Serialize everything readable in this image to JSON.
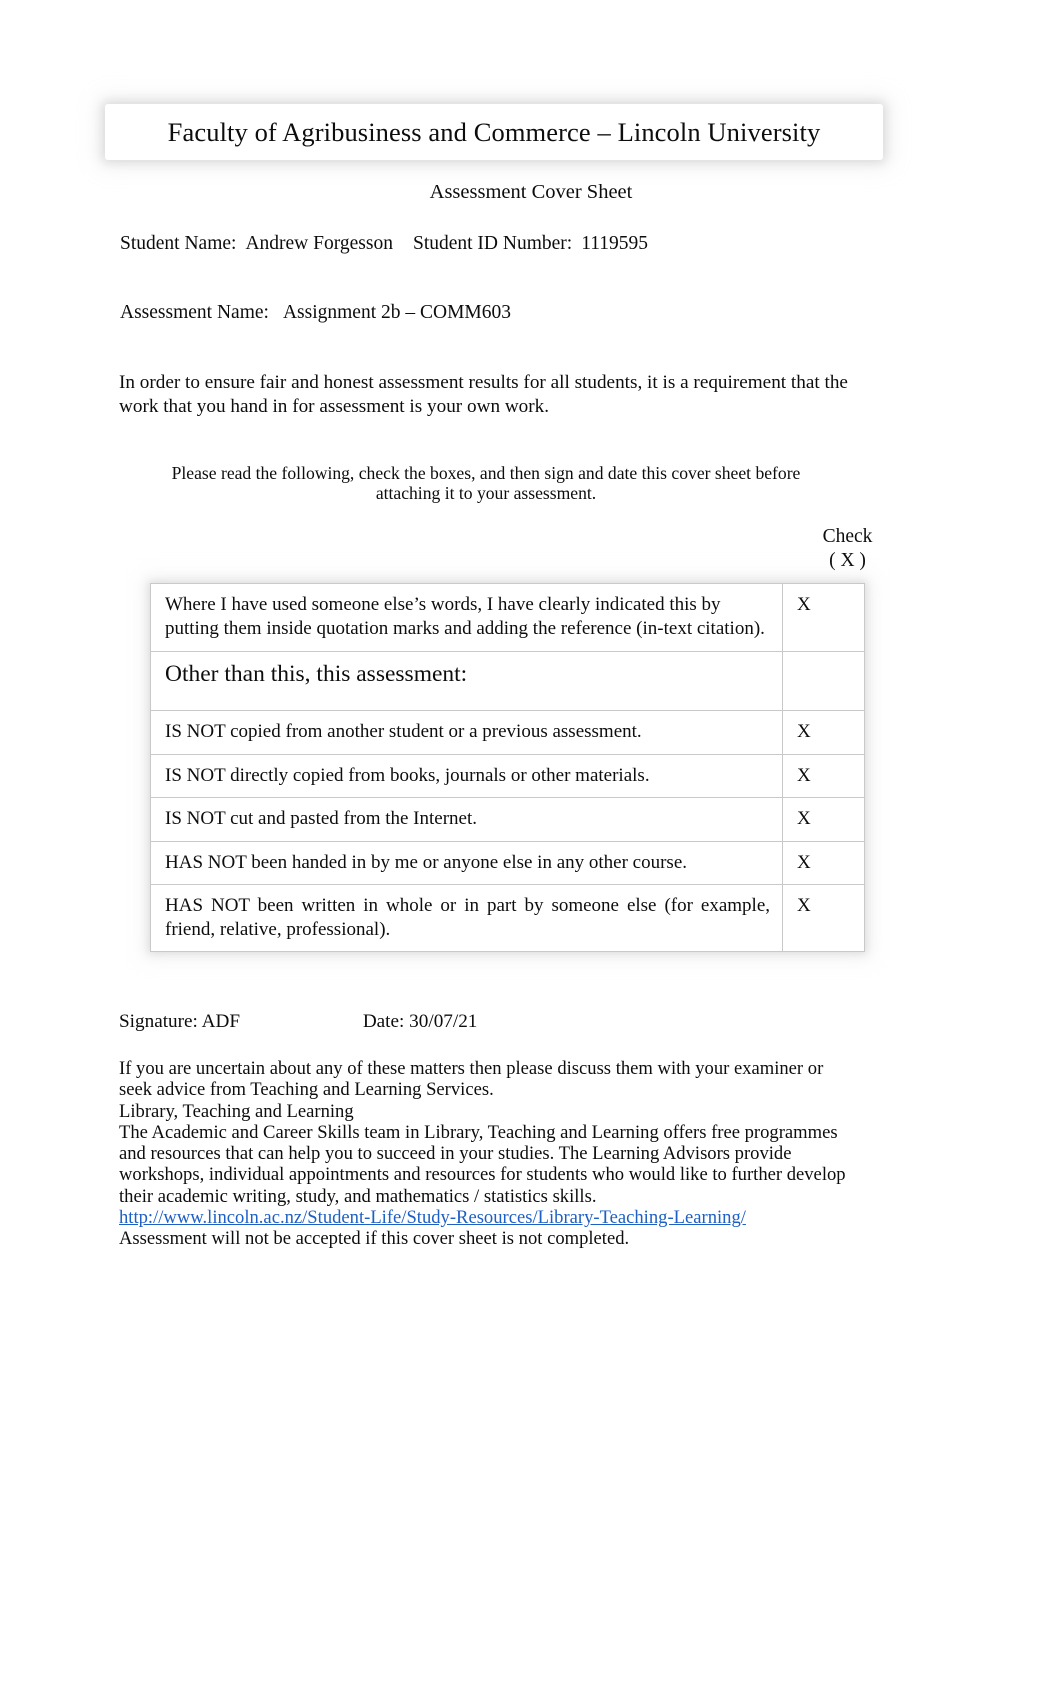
{
  "document": {
    "header_title": "Faculty of Agribusiness and Commerce – Lincoln University",
    "subtitle": "Assessment Cover Sheet"
  },
  "student": {
    "name_label": "Student Name:",
    "name_value": "Andrew Forgesson",
    "id_label": "Student ID Number:",
    "id_value": "1119595"
  },
  "assessment": {
    "label": "Assessment Name:",
    "value": "Assignment 2b – COMM603"
  },
  "intro": {
    "paragraph": "In order to ensure fair and honest assessment results for all students, it is a requirement that the work that you hand in for assessment is your own work.",
    "instruction": "Please read the following, check the boxes, and then sign and date this cover sheet before attaching it to your assessment."
  },
  "table": {
    "check_header_line1": "Check",
    "check_header_line2": "( X )",
    "rows": [
      {
        "statement": "Where I have used someone else’s words, I have clearly indicated this by putting them inside quotation marks and adding the reference (in-text citation).",
        "check": "X",
        "style": "tall"
      },
      {
        "statement": "Other than this, this assessment:",
        "check": "",
        "style": "big"
      },
      {
        "statement": "IS NOT copied from another student or a previous assessment.",
        "check": "X",
        "style": "normal"
      },
      {
        "statement": "IS NOT directly copied from books, journals or other materials.",
        "check": "X",
        "style": "normal"
      },
      {
        "statement": "IS NOT cut and pasted from the Internet.",
        "check": "X",
        "style": "normal"
      },
      {
        "statement": "HAS NOT been handed in by me or anyone else in any other course.",
        "check": "X",
        "style": "normal"
      },
      {
        "statement": "HAS NOT been written in whole or in part by someone else (for example, friend, relative, professional).",
        "check": "X",
        "style": "justify"
      }
    ]
  },
  "signature": {
    "signature_label": "Signature:",
    "signature_value": "ADF",
    "date_label": "Date:",
    "date_value": "30/07/21"
  },
  "footer": {
    "line1": "If you are uncertain about any of these matters then please discuss them with your examiner or seek advice from Teaching and Learning Services.",
    "line2": "Library, Teaching and Learning",
    "line3": "The Academic and Career Skills team in Library, Teaching and Learning offers free programmes and resources that can help you to succeed in your studies. The Learning Advisors provide workshops, individual appointments and resources for students who would like to further develop their academic writing, study, and mathematics / statistics skills.",
    "link_text": "http://www.lincoln.ac.nz/Student-Life/Study-Resources/Library-Teaching-Learning/",
    "line4": "Assessment will not be accepted if this cover sheet is not completed."
  },
  "colors": {
    "link": "#1d5fc4",
    "text": "#0d0d0d",
    "table_border": "#c9c9c9"
  }
}
